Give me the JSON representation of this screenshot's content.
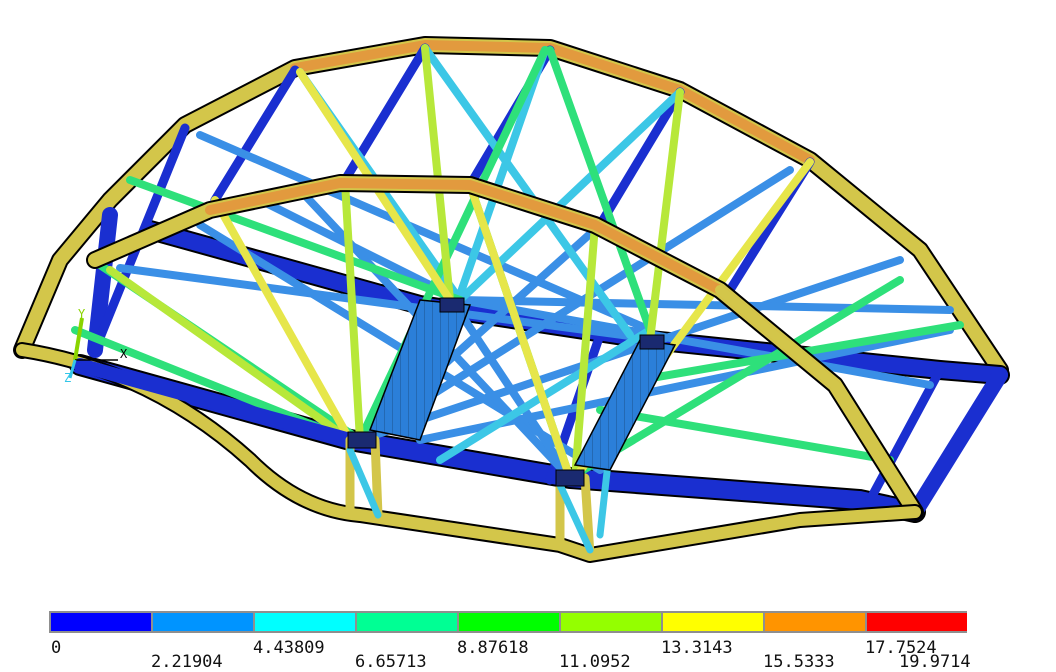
{
  "legend": {
    "colors": [
      "#0000ff",
      "#0094ff",
      "#00ffff",
      "#00ff94",
      "#00ff00",
      "#94ff00",
      "#ffff00",
      "#ff9400",
      "#ff0000"
    ],
    "labels": [
      "0",
      "2.21904",
      "4.43809",
      "6.65713",
      "8.87618",
      "11.0952",
      "13.3143",
      "15.5333",
      "17.7524",
      "19.9714"
    ]
  },
  "axis_triad": {
    "x": "X",
    "y": "Y",
    "z": "Z"
  },
  "structure_colors": {
    "arch_top": "#e8c84a",
    "arch_peak": "#e89a3a",
    "beam_blue": "#1a2fd0",
    "diag_cyan": "#3cc7e6",
    "diag_lightblue": "#3a8fe6",
    "diag_green": "#2ee07a",
    "diag_yellowgreen": "#b7e83a",
    "diag_yellow": "#e6e64a"
  }
}
